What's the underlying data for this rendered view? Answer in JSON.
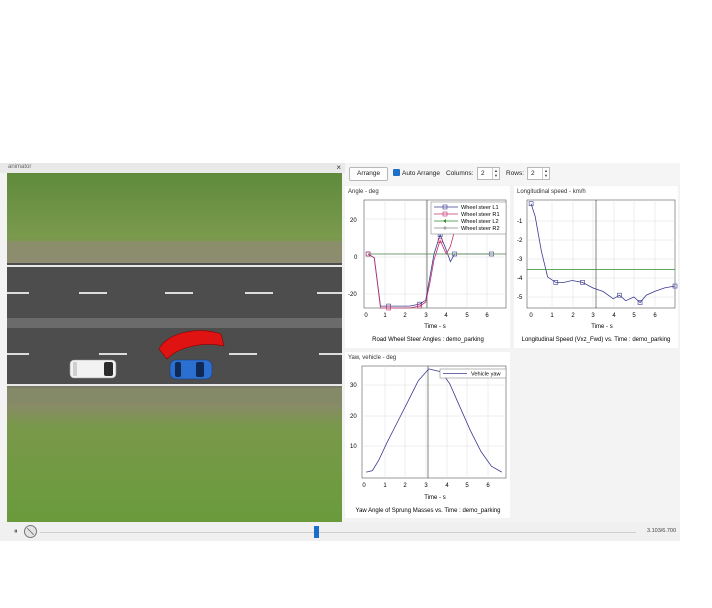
{
  "window": {
    "title": "animator"
  },
  "toolbar": {
    "arrange_label": "Arrange",
    "auto_arrange_label": "Auto Arrange",
    "auto_arrange_checked": true,
    "columns_label": "Columns:",
    "columns_value": "2",
    "rows_label": "Rows:",
    "rows_value": "2"
  },
  "plots": {
    "steer": {
      "title": "Angle - deg",
      "xlabel": "Time - s",
      "caption": "Road Wheel Steer Angles : demo_parking",
      "yticks": [
        "20",
        "0",
        "-20"
      ],
      "xticks": [
        "0",
        "1",
        "2",
        "3",
        "4",
        "5",
        "6"
      ],
      "legend": [
        "Wheel steer L1",
        "Wheel steer R1",
        "Wheel steer L2",
        "Wheel steer R2"
      ]
    },
    "speed": {
      "title": "Longitudinal speed - km/h",
      "xlabel": "Time - s",
      "caption": "Longitudinal Speed (Vxz_Fwd) vs. Time : demo_parking",
      "yticks": [
        "-1",
        "-2",
        "-3",
        "-4",
        "-5"
      ],
      "xticks": [
        "0",
        "1",
        "2",
        "3",
        "4",
        "5",
        "6"
      ]
    },
    "yaw": {
      "title": "Yaw, vehicle - deg",
      "xlabel": "Time - s",
      "caption": "Yaw Angle of Sprung Masses vs. Time : demo_parking",
      "yticks": [
        "30",
        "20",
        "10"
      ],
      "xticks": [
        "0",
        "1",
        "2",
        "3",
        "4",
        "5",
        "6"
      ],
      "legend": [
        "Vehicle yaw"
      ]
    }
  },
  "playback": {
    "time_label": "3.103/6.700",
    "progress": 0.463
  },
  "colors": {
    "accent": "#1b6fcb",
    "curve": "#3b3b8f",
    "l2": "#2e8b2e",
    "r1": "#c0306a"
  },
  "chart_data": [
    {
      "type": "line",
      "title": "Angle - deg",
      "xlabel": "Time - s",
      "ylabel": "",
      "xlim": [
        -0.2,
        6.7
      ],
      "ylim": [
        -28,
        28
      ],
      "series": [
        {
          "name": "Wheel steer L1",
          "x": [
            0,
            0.3,
            0.6,
            1,
            1.5,
            2,
            2.5,
            2.8,
            3.0,
            3.2,
            3.5,
            3.8,
            4.0,
            4.2,
            4.5,
            5,
            6
          ],
          "values": [
            0,
            -2,
            -27,
            -27,
            -27,
            -27,
            -26,
            -24,
            -12,
            0,
            10,
            2,
            -4,
            0,
            0,
            0,
            0
          ]
        },
        {
          "name": "Wheel steer R1",
          "x": [
            0,
            0.3,
            0.6,
            1,
            1.5,
            2,
            2.5,
            2.8,
            3.0,
            3.2,
            3.5,
            3.8,
            4.0,
            4.2,
            4.5,
            5,
            6
          ],
          "values": [
            0,
            -2,
            -28,
            -28,
            -28,
            -28,
            -27,
            -25,
            -15,
            -3,
            7,
            0,
            4,
            12,
            14,
            12,
            12
          ]
        },
        {
          "name": "Wheel steer L2",
          "x": [
            0,
            6.7
          ],
          "values": [
            0,
            0
          ]
        },
        {
          "name": "Wheel steer R2",
          "x": [
            0,
            6.7
          ],
          "values": [
            0,
            0
          ]
        }
      ]
    },
    {
      "type": "line",
      "title": "Longitudinal speed - km/h",
      "xlabel": "Time - s",
      "ylabel": "",
      "xlim": [
        -0.2,
        7
      ],
      "ylim": [
        -5.7,
        0.2
      ],
      "series": [
        {
          "name": "",
          "x": [
            0,
            0.2,
            0.5,
            0.8,
            1.2,
            1.6,
            2,
            2.5,
            3,
            3.5,
            4,
            4.3,
            4.6,
            5,
            5.3,
            5.6,
            6,
            6.5,
            7
          ],
          "values": [
            0,
            -0.7,
            -2.6,
            -4.0,
            -4.3,
            -4.3,
            -4.2,
            -4.3,
            -4.6,
            -4.8,
            -5.2,
            -5.0,
            -5.3,
            -5.1,
            -5.4,
            -5.0,
            -4.8,
            -4.6,
            -4.5
          ]
        },
        {
          "name": "",
          "x": [
            -0.2,
            7
          ],
          "values": [
            -3.6,
            -3.6
          ]
        }
      ]
    },
    {
      "type": "line",
      "title": "Yaw, vehicle - deg",
      "xlabel": "Time - s",
      "ylabel": "",
      "xlim": [
        -0.2,
        6.7
      ],
      "ylim": [
        -2,
        36
      ],
      "series": [
        {
          "name": "Vehicle yaw",
          "x": [
            0,
            0.3,
            0.6,
            1,
            1.5,
            2,
            2.5,
            3.0,
            3.3,
            3.6,
            4,
            4.5,
            5,
            5.5,
            6,
            6.5
          ],
          "values": [
            0,
            0.5,
            4,
            10,
            17,
            24,
            31,
            35,
            34.5,
            34,
            30,
            22,
            14,
            7,
            2,
            0
          ]
        }
      ]
    }
  ]
}
